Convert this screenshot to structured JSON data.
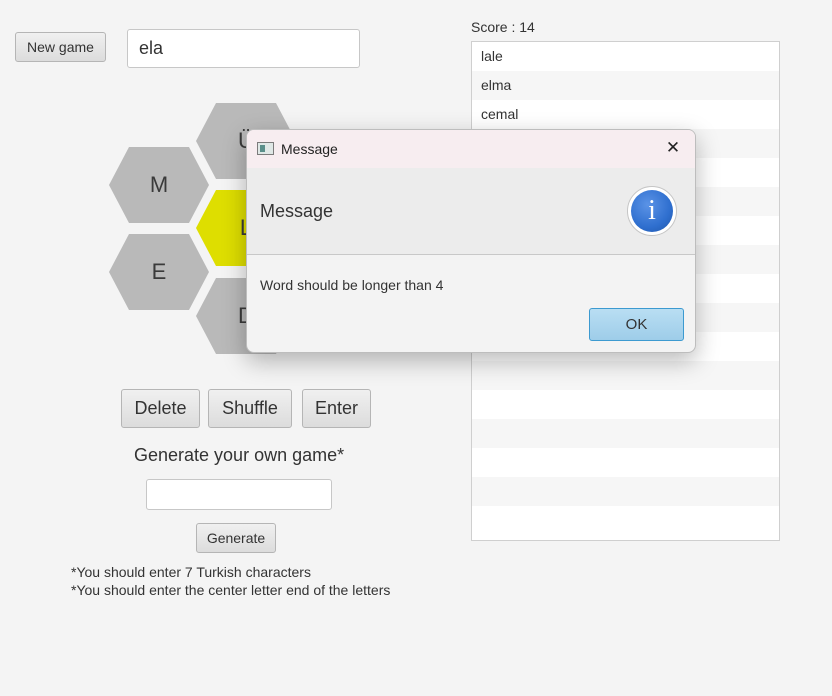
{
  "toolbar": {
    "new_game_label": "New game",
    "word_input_value": "ela"
  },
  "score": {
    "label": "Score : 14"
  },
  "words": [
    "lale",
    "elma",
    "cemal",
    "",
    "",
    "",
    "",
    "",
    "",
    "",
    "",
    "",
    "",
    "",
    "",
    "",
    ""
  ],
  "hexagons": {
    "top": "Ü",
    "upper_left": "M",
    "center": "L",
    "lower_left": "E",
    "bottom": "D"
  },
  "controls": {
    "delete_label": "Delete",
    "shuffle_label": "Shuffle",
    "enter_label": "Enter"
  },
  "generate": {
    "title": "Generate your own game*",
    "input_value": "",
    "button_label": "Generate",
    "note_1": "*You should enter 7 Turkish characters",
    "note_2": "*You should enter the center letter end of the letters"
  },
  "dialog": {
    "window_title": "Message",
    "header_text": "Message",
    "info_icon": "i",
    "body_text": "Word should be longer than 4",
    "ok_label": "OK",
    "close_glyph": "✕"
  },
  "colors": {
    "center_hex": "#dede00",
    "outer_hex": "#b9b9b9",
    "info_blue": "#2f6fcf",
    "ok_button": "#a9d5ee"
  }
}
